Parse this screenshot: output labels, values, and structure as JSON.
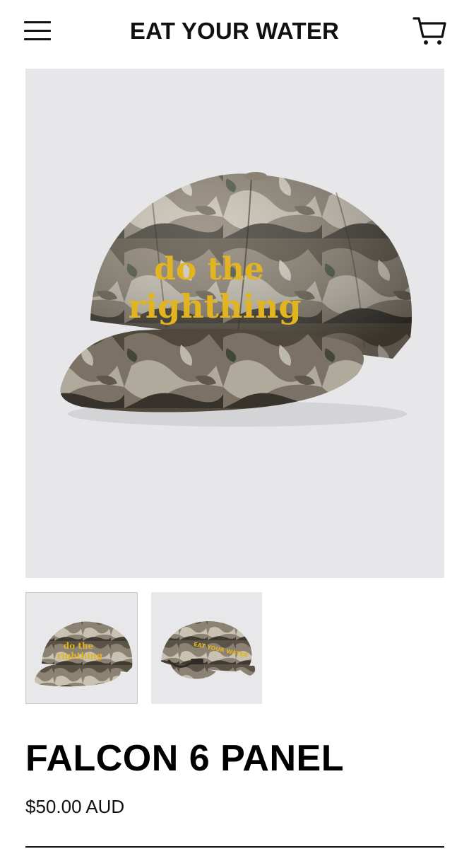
{
  "header": {
    "brand": "EAT YOUR WATER",
    "menu_icon": "hamburger-menu-icon",
    "cart_icon": "shopping-cart-icon"
  },
  "product": {
    "title": "FALCON 6 PANEL",
    "price": "$50.00 AUD",
    "embroidery_line_1": "do the",
    "embroidery_line_2": "righthing",
    "thumbnails": [
      {
        "label": "front view"
      },
      {
        "label": "back view"
      }
    ]
  },
  "colors": {
    "embroidery": "#e2b420",
    "photo_background": "#e7e7e9"
  }
}
